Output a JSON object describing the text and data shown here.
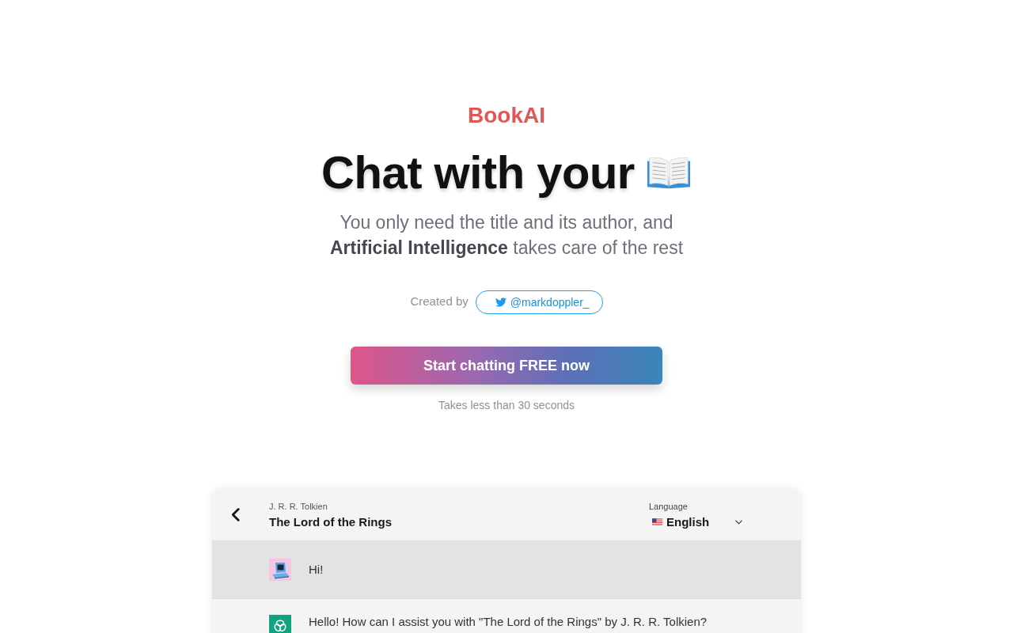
{
  "brand": "BookAI",
  "hero": {
    "title": "Chat with your",
    "subtitle_lines": [
      "You only need the title and its author, and",
      "**Artificial Intelligence** takes care of the rest"
    ]
  },
  "credit": {
    "label": "Created by",
    "handle": "@markdoppler_"
  },
  "cta": {
    "label": "Start chatting FREE now",
    "note": "Takes less than 30 seconds"
  },
  "preview": {
    "author": "J. R. R. Tolkien",
    "book_title": "The Lord of the Rings",
    "language": {
      "label": "Language",
      "value": "English"
    },
    "messages": [
      {
        "kind": "user",
        "text": "Hi!"
      },
      {
        "kind": "assistant",
        "text": "Hello! How can I assist you with \"The Lord of the Rings\" by J. R. R. Tolkien?"
      }
    ]
  }
}
